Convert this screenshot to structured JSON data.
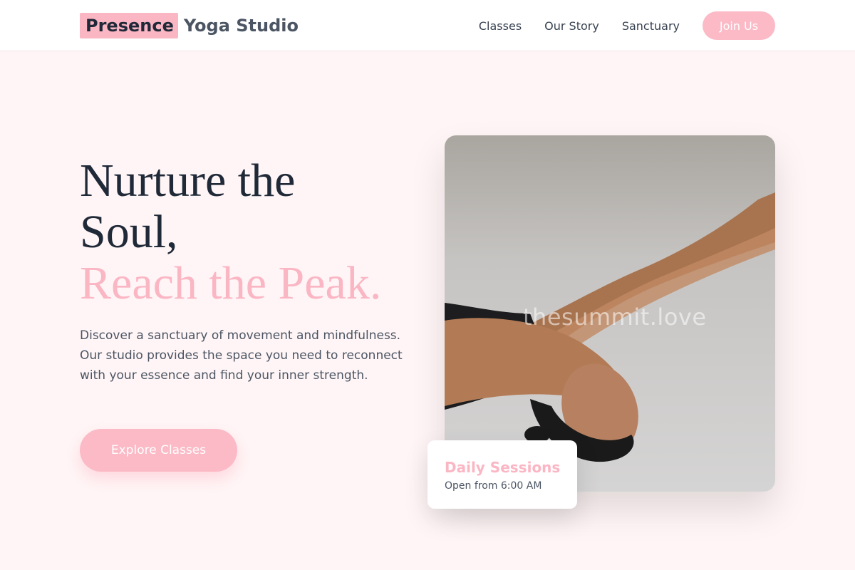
{
  "header": {
    "logo_mark": "Presence",
    "logo_rest": "Yoga Studio",
    "nav": [
      "Classes",
      "Our Story",
      "Sanctuary"
    ],
    "cta": "Join Us"
  },
  "hero": {
    "headline_line1": "Nurture the",
    "headline_line2": "Soul,",
    "headline_line3": "Reach the Peak.",
    "intro": "Discover a sanctuary of movement and mindfulness. Our studio provides the space you need to reconnect with your essence and find your inner strength.",
    "cta": "Explore Classes"
  },
  "image": {
    "watermark": "thesummit.love"
  },
  "card": {
    "title": "Daily Sessions",
    "subtitle": "Open from 6:00 AM"
  },
  "colors": {
    "accent": "#fbb6c4",
    "background": "#fff5f6",
    "text": "#1f2937"
  }
}
